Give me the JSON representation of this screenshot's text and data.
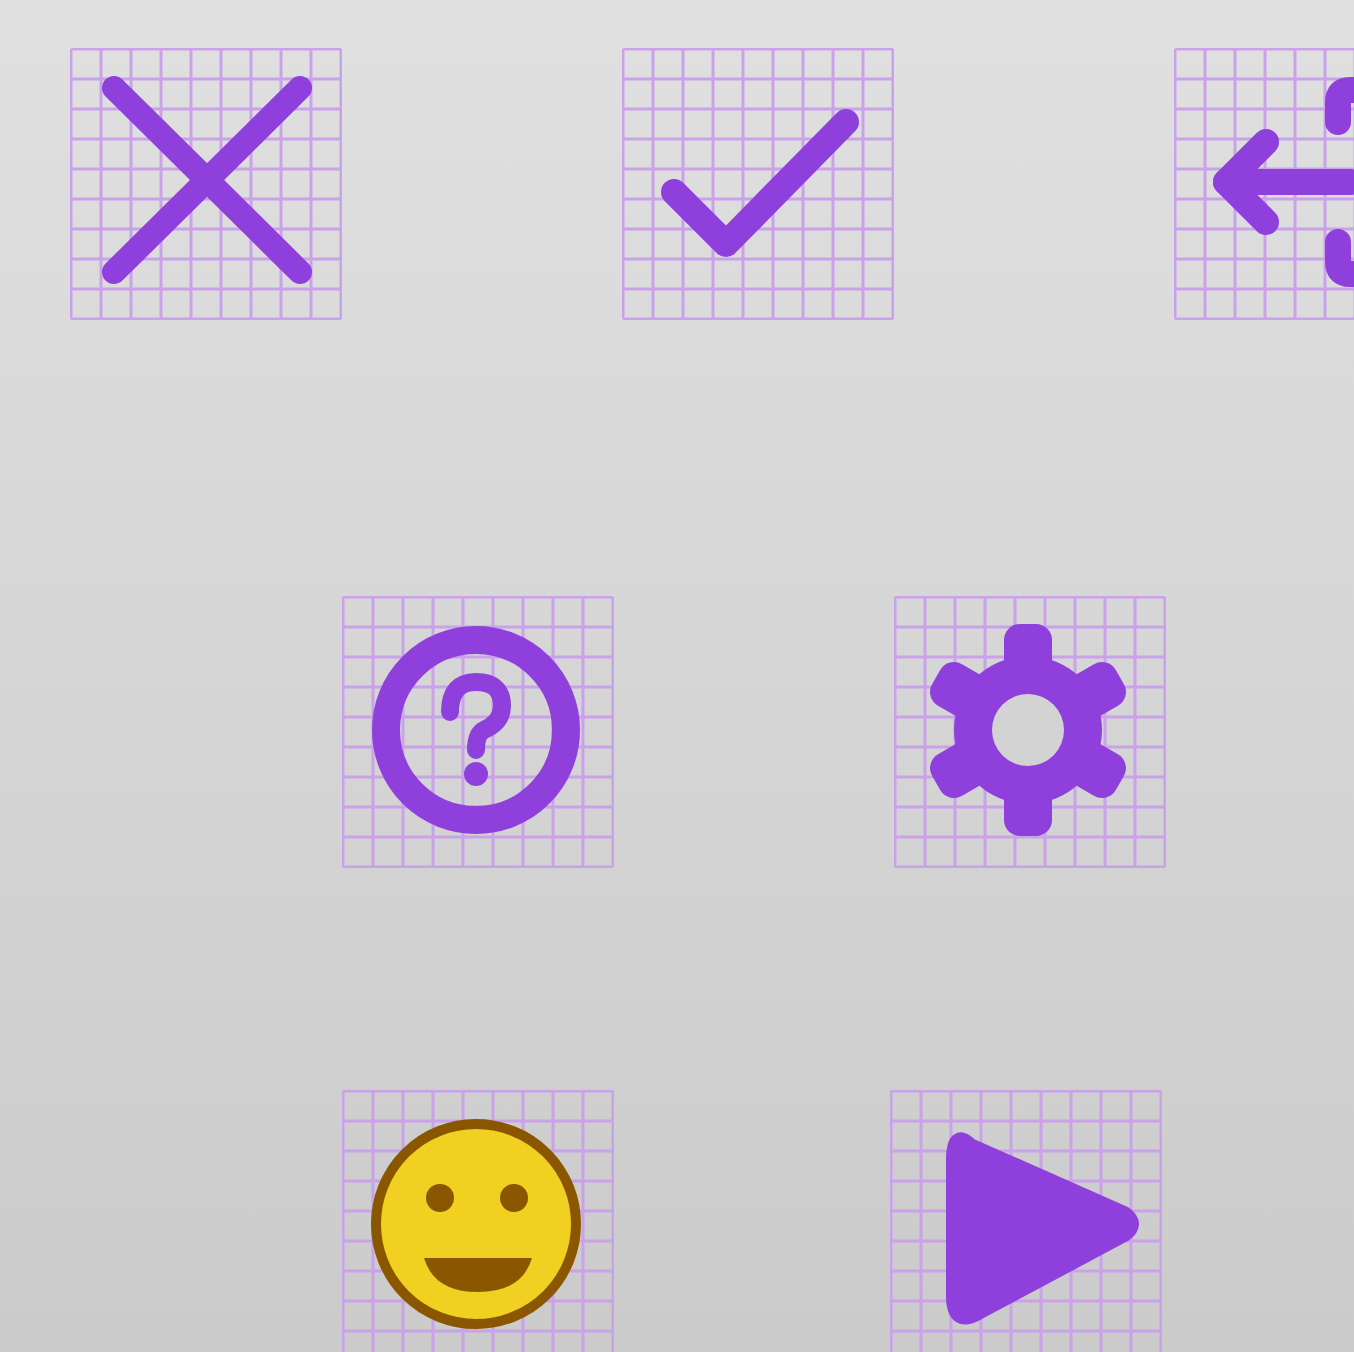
{
  "rows": [
    [
      {
        "kind": "close"
      },
      {
        "kind": "check"
      },
      {
        "kind": "exit"
      }
    ],
    [
      {
        "kind": "help"
      },
      {
        "kind": "settings"
      }
    ],
    [
      {
        "kind": "smiley"
      },
      {
        "kind": "play"
      }
    ]
  ]
}
